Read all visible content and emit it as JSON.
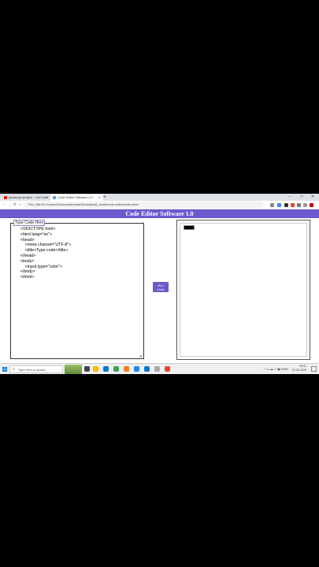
{
  "browser": {
    "tabs": [
      {
        "label": "javascript project - YouTube",
        "favicon_color": "#ff0000"
      },
      {
        "label": "Code Editor Software 1.0",
        "favicon_color": "#5b9bd5"
      }
    ],
    "new_tab_label": "+",
    "window_controls": {
      "minimize": "–",
      "maximize": "□",
      "close": "✕"
    },
    "nav": {
      "back": "←",
      "forward": "→",
      "reload": "⟳",
      "home": "⌂"
    },
    "url": "File | file:///C:/Users/Gulshanhammad/Desktop/all_study/code-editor/index.html",
    "extension_colors": [
      "#888888",
      "#4285f4",
      "#333333",
      "#ea4335",
      "#777777",
      "#999999",
      "#c00000",
      "#555555"
    ]
  },
  "app": {
    "title": "Code Editor Software 1.0",
    "accent_color": "#6a5acd",
    "editor": {
      "label": "Type Code Here",
      "lines": [
        "        <!DOCTYPE html>",
        "        <html lang=\"en\">",
        "        <head>",
        "            <meta charset=\"UTF-8\">",
        "            <title>Type code</title>",
        "        </head>",
        "        <body>",
        "            <input type=\"color\">",
        "        </body>",
        "        </html>"
      ]
    },
    "run_button": {
      "line1": "Run",
      "line2": "Code"
    },
    "output": {
      "color_input_value": "#000000"
    }
  },
  "taskbar": {
    "search_placeholder": "Type here to search",
    "app_icon_colors": [
      "#444444",
      "#ffb900",
      "#0078d7",
      "#34a853",
      "#f48024",
      "#1e88e5",
      "#007acc",
      "#aaaaaa",
      "#ea4335"
    ],
    "tray_text": "^ ▭ ☁ ⌂ ◀) ENG",
    "time": "09:51",
    "date": "07-09-2022"
  }
}
